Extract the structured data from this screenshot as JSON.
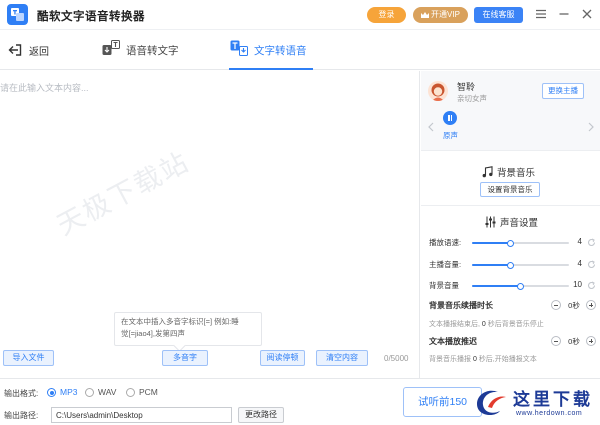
{
  "app": {
    "title": "酷软文字语音转换器",
    "login_label": "登录",
    "vip_label": "开通VIP",
    "service_label": "在线客服"
  },
  "tabs": {
    "back_label": "返回",
    "speech_to_text_label": "语音转文字",
    "text_to_speech_label": "文字转语音",
    "active": "text_to_speech"
  },
  "editor": {
    "placeholder": "请在此输入文本内容...",
    "watermark": "天极下载站",
    "tip_line1": "在文本中插入多音字标识[=] 例如:睡",
    "tip_line2": "觉[=jiao4],发第四声",
    "import_label": "导入文件",
    "polyphone_label": "多音字",
    "pause_label": "阅读停顿",
    "clear_label": "清空内容",
    "char_count": "0/5000"
  },
  "voice": {
    "name": "智聆",
    "description": "亲切女声",
    "change_label": "更换主播",
    "play_label": "原声"
  },
  "bgm": {
    "title": "背景音乐",
    "set_label": "设置背景音乐"
  },
  "sound": {
    "title": "声音设置",
    "sliders": [
      {
        "label": "播放语速:",
        "value": "4",
        "fraction": 0.4
      },
      {
        "label": "主播音量:",
        "value": "4",
        "fraction": 0.4
      },
      {
        "label": "背景音量",
        "value": "10",
        "fraction": 0.5
      }
    ],
    "bgm_duration": {
      "label": "背景音乐续播时长",
      "value": "0秒",
      "hint_prefix": "文本播报结束后,",
      "hint_num": "0",
      "hint_suffix": "秒后背景音乐停止"
    },
    "text_delay": {
      "label": "文本播放推迟",
      "value": "0秒",
      "hint_prefix": "背景音乐播报",
      "hint_num": "0",
      "hint_suffix": "秒后,开始播报文本"
    }
  },
  "output": {
    "format_label": "输出格式:",
    "formats": [
      "MP3",
      "WAV",
      "PCM"
    ],
    "selected_format": "MP3",
    "path_label": "输出路径:",
    "path_value": "C:\\Users\\admin\\Desktop",
    "change_path_label": "更改路径",
    "trial_label": "试听前150"
  },
  "brand": {
    "text": "这里下载",
    "url": "www.herdown.com"
  },
  "colors": {
    "accent": "#2f7ff5",
    "login": "#f6a43a",
    "vip": "#d9a15c"
  }
}
